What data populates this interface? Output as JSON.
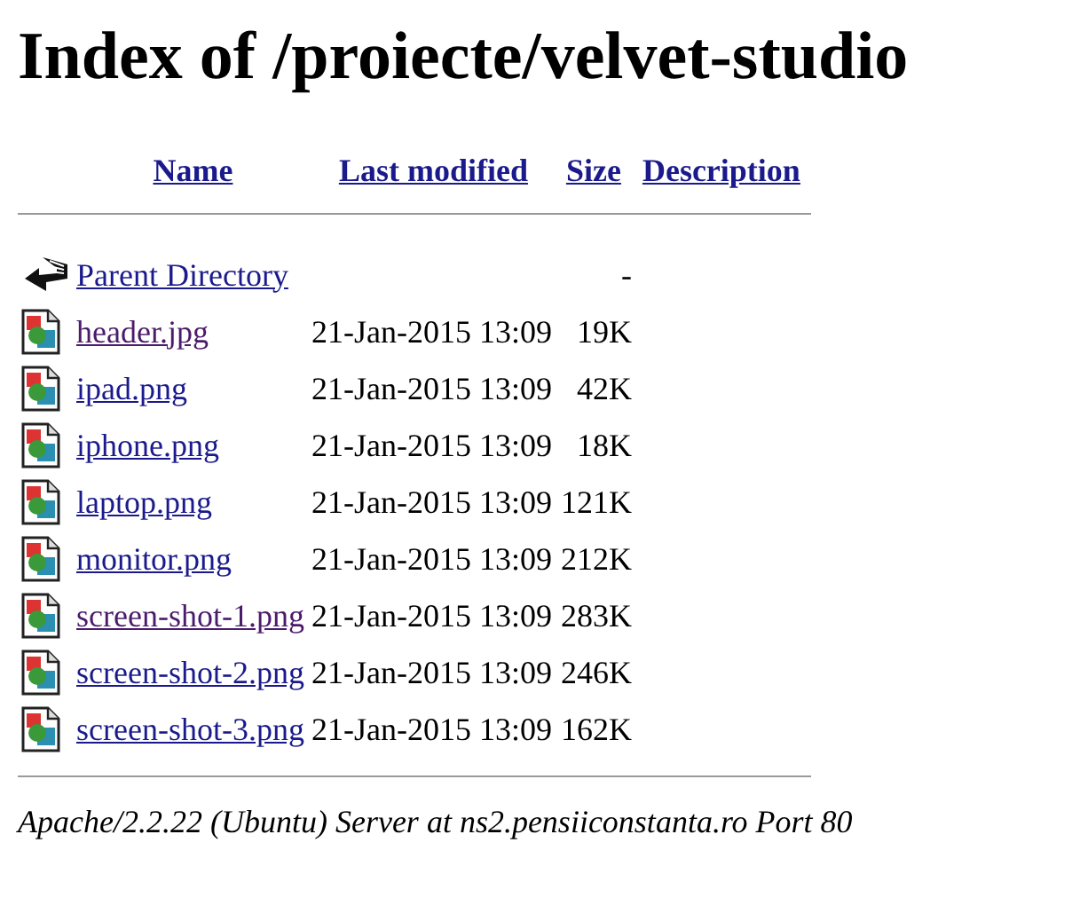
{
  "title": "Index of /proiecte/velvet-studio",
  "columns": [
    "Name",
    "Last modified",
    "Size",
    "Description"
  ],
  "rows": [
    {
      "kind": "parent",
      "name": "Parent Directory",
      "modified": "",
      "size": "-",
      "visited": false
    },
    {
      "kind": "image",
      "name": "header.jpg",
      "modified": "21-Jan-2015 13:09",
      "size": "19K",
      "visited": true
    },
    {
      "kind": "image",
      "name": "ipad.png",
      "modified": "21-Jan-2015 13:09",
      "size": "42K",
      "visited": false
    },
    {
      "kind": "image",
      "name": "iphone.png",
      "modified": "21-Jan-2015 13:09",
      "size": "18K",
      "visited": false
    },
    {
      "kind": "image",
      "name": "laptop.png",
      "modified": "21-Jan-2015 13:09",
      "size": "121K",
      "visited": false
    },
    {
      "kind": "image",
      "name": "monitor.png",
      "modified": "21-Jan-2015 13:09",
      "size": "212K",
      "visited": false
    },
    {
      "kind": "image",
      "name": "screen-shot-1.png",
      "modified": "21-Jan-2015 13:09",
      "size": "283K",
      "visited": true
    },
    {
      "kind": "image",
      "name": "screen-shot-2.png",
      "modified": "21-Jan-2015 13:09",
      "size": "246K",
      "visited": false
    },
    {
      "kind": "image",
      "name": "screen-shot-3.png",
      "modified": "21-Jan-2015 13:09",
      "size": "162K",
      "visited": false
    }
  ],
  "footer": "Apache/2.2.22 (Ubuntu) Server at ns2.pensiiconstanta.ro Port 80"
}
